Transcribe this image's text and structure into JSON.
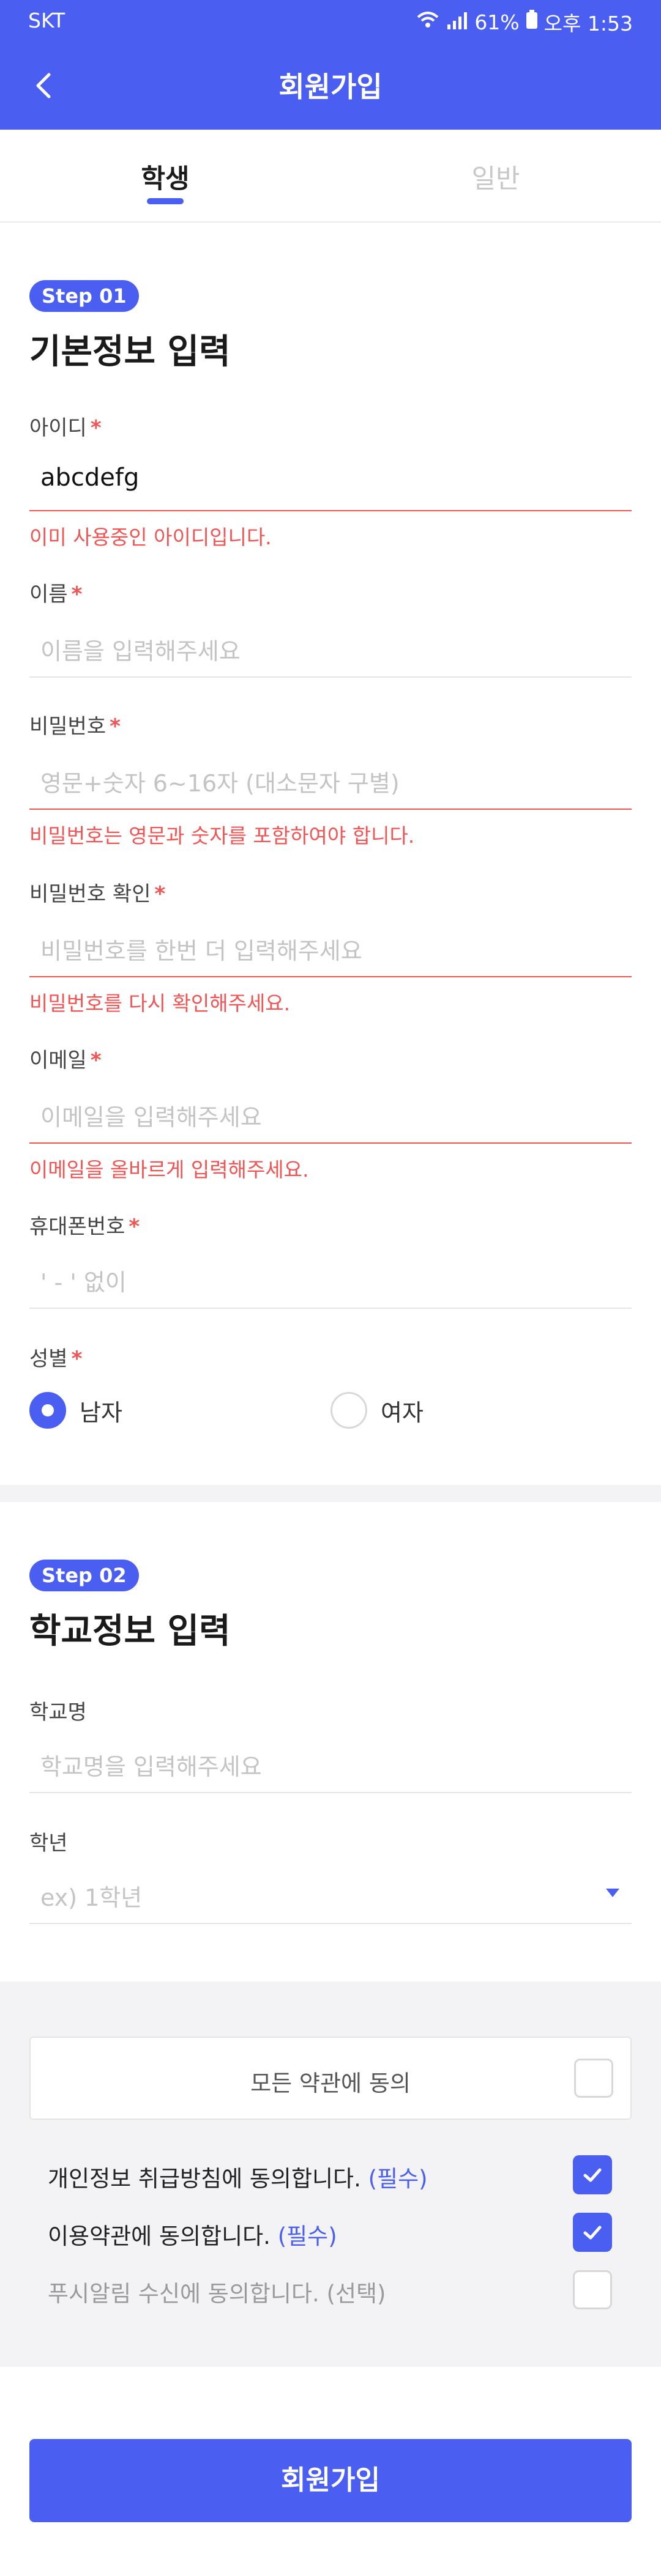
{
  "status_bar": {
    "carrier": "SKT",
    "battery": "61%",
    "time": "오후 1:53"
  },
  "app_bar": {
    "title": "회원가입",
    "back_icon": "chevron-left-icon"
  },
  "tabs": [
    {
      "label": "학생",
      "active": true
    },
    {
      "label": "일반",
      "active": false
    }
  ],
  "step1": {
    "badge": "Step 01",
    "title": "기본정보 입력",
    "fields": {
      "id": {
        "label": "아이디",
        "value": "abcdefg",
        "error": "이미 사용중인 아이디입니다."
      },
      "name": {
        "label": "이름",
        "placeholder": "이름을 입력해주세요"
      },
      "password": {
        "label": "비밀번호",
        "placeholder": "영문+숫자 6~16자 (대소문자 구별)",
        "error": "비밀번호는 영문과 숫자를 포함하여야 합니다."
      },
      "password_confirm": {
        "label": "비밀번호 확인",
        "placeholder": "비밀번호를 한번 더 입력해주세요",
        "error": "비밀번호를 다시 확인해주세요."
      },
      "email": {
        "label": "이메일",
        "placeholder": "이메일을 입력해주세요",
        "error": "이메일을 올바르게 입력해주세요."
      },
      "phone": {
        "label": "휴대폰번호",
        "placeholder": "' - ' 없이"
      }
    },
    "gender": {
      "label": "성별",
      "options": [
        {
          "label": "남자",
          "selected": true
        },
        {
          "label": "여자",
          "selected": false
        }
      ]
    },
    "required_mark": "*"
  },
  "step2": {
    "badge": "Step 02",
    "title": "학교정보 입력",
    "school": {
      "label": "학교명",
      "placeholder": "학교명을 입력해주세요"
    },
    "grade": {
      "label": "학년",
      "placeholder": "ex) 1학년"
    }
  },
  "agreements": {
    "all_label": "모든 약관에 동의",
    "items": [
      {
        "text": "개인정보 취급방침에 동의합니다.",
        "tag": "(필수)",
        "checked": true
      },
      {
        "text": "이용약관에 동의합니다.",
        "tag": "(필수)",
        "checked": true
      },
      {
        "text": "푸시알림 수신에 동의합니다. (선택)",
        "tag": "",
        "checked": false
      }
    ]
  },
  "submit_label": "회원가입",
  "colors": {
    "primary": "#4a5ff2",
    "error": "#f25454",
    "background_gray": "#f3f3f5"
  }
}
